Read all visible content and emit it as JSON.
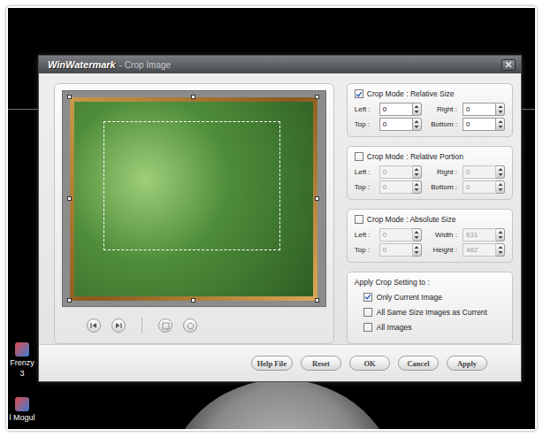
{
  "window": {
    "title": "WinWatermark",
    "title_suffix": "- Crop Image"
  },
  "crop_modes": [
    {
      "label": "Crop Mode : Relative Size",
      "checked": true,
      "fields": [
        {
          "label": "Left :",
          "value": "0",
          "disabled": false
        },
        {
          "label": "Right :",
          "value": "0",
          "disabled": false
        },
        {
          "label": "Top :",
          "value": "0",
          "disabled": false
        },
        {
          "label": "Bottom :",
          "value": "0",
          "disabled": false
        }
      ]
    },
    {
      "label": "Crop Mode : Relative Portion",
      "checked": false,
      "fields": [
        {
          "label": "Left :",
          "value": "0",
          "disabled": true
        },
        {
          "label": "Right :",
          "value": "0",
          "disabled": true
        },
        {
          "label": "Top :",
          "value": "0",
          "disabled": true
        },
        {
          "label": "Bottom :",
          "value": "0",
          "disabled": true
        }
      ]
    },
    {
      "label": "Crop Mode : Absolute Size",
      "checked": false,
      "fields": [
        {
          "label": "Left :",
          "value": "0",
          "disabled": true
        },
        {
          "label": "Width :",
          "value": "631",
          "disabled": true
        },
        {
          "label": "Top :",
          "value": "0",
          "disabled": true
        },
        {
          "label": "Height :",
          "value": "482",
          "disabled": true
        }
      ]
    }
  ],
  "apply": {
    "label": "Apply Crop Setting to :",
    "options": [
      {
        "label": "Only Current Image",
        "checked": true
      },
      {
        "label": "All Same Size Images as Current",
        "checked": false
      },
      {
        "label": "All Images",
        "checked": false
      }
    ]
  },
  "buttons": [
    "Help File",
    "Reset",
    "OK",
    "Cancel",
    "Apply"
  ],
  "desktop_icons": [
    {
      "lines": [
        "Frenzy",
        "3"
      ]
    },
    {
      "lines": [
        "l Mogul"
      ]
    }
  ]
}
